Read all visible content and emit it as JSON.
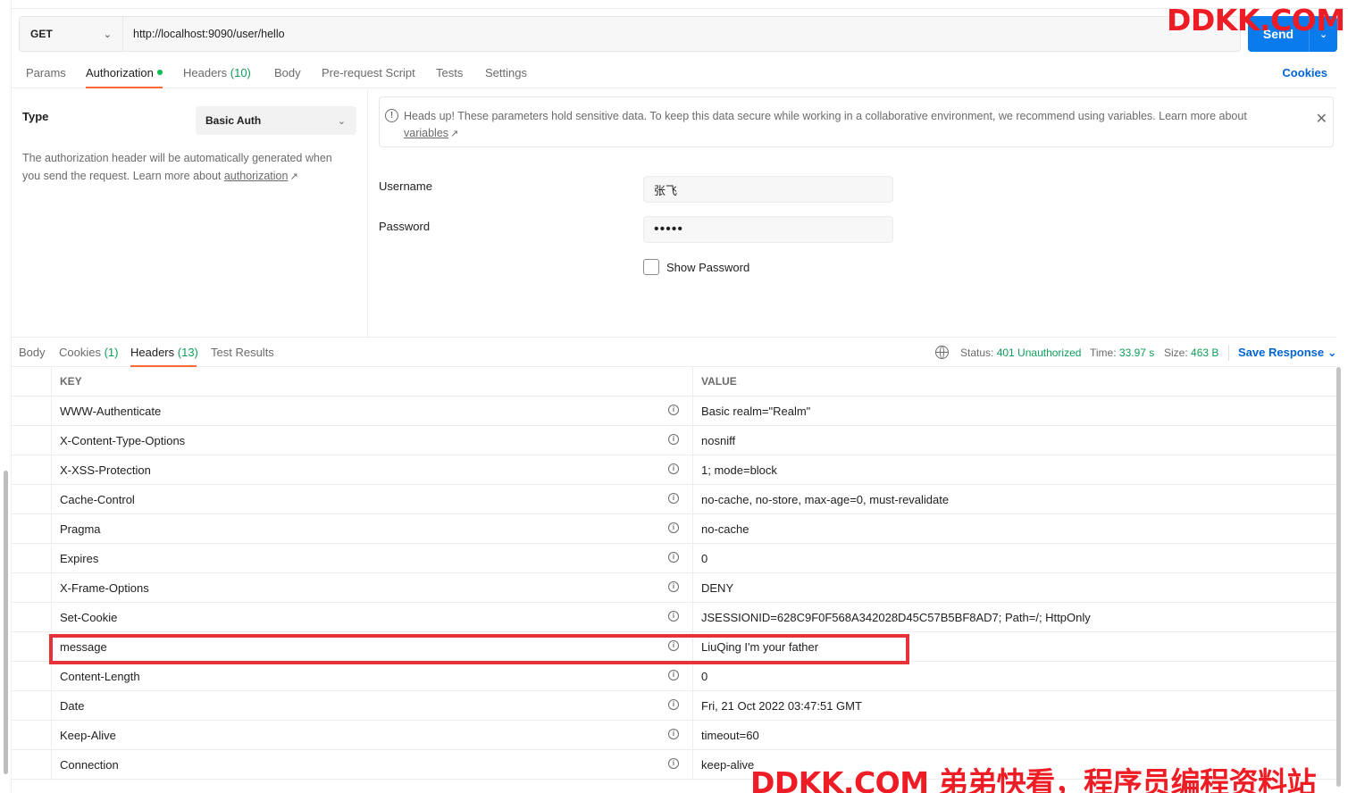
{
  "request": {
    "method": "GET",
    "url": "http://localhost:9090/user/hello",
    "send_label": "Send"
  },
  "request_tabs": [
    {
      "label": "Params",
      "count": ""
    },
    {
      "label": "Authorization",
      "count": ""
    },
    {
      "label": "Headers",
      "count": "(10)"
    },
    {
      "label": "Body",
      "count": ""
    },
    {
      "label": "Pre-request Script",
      "count": ""
    },
    {
      "label": "Tests",
      "count": ""
    },
    {
      "label": "Settings",
      "count": ""
    }
  ],
  "active_request_tab": "Authorization",
  "cookies_link": "Cookies",
  "auth": {
    "type_label": "Type",
    "type_value": "Basic Auth",
    "desc_prefix": "The authorization header will be automatically generated when you send the request. Learn more about",
    "desc_link": "authorization",
    "banner_text": "Heads up! These parameters hold sensitive data. To keep this data secure while working in a collaborative environment, we recommend using variables. Learn more about",
    "banner_link": "variables",
    "username_label": "Username",
    "username_value": "张飞",
    "password_label": "Password",
    "password_value": "•••••",
    "show_password_label": "Show Password"
  },
  "response_tabs": [
    {
      "label": "Body",
      "count": ""
    },
    {
      "label": "Cookies",
      "count": "(1)"
    },
    {
      "label": "Headers",
      "count": "(13)"
    },
    {
      "label": "Test Results",
      "count": ""
    }
  ],
  "active_response_tab": "Headers",
  "response_meta": {
    "status_label": "Status:",
    "status_value": "401 Unauthorized",
    "time_label": "Time:",
    "time_value": "33.97 s",
    "size_label": "Size:",
    "size_value": "463 B",
    "save_label": "Save Response"
  },
  "headers_table": {
    "columns": [
      "KEY",
      "VALUE"
    ],
    "rows": [
      {
        "key": "WWW-Authenticate",
        "value": "Basic realm=\"Realm\""
      },
      {
        "key": "X-Content-Type-Options",
        "value": "nosniff"
      },
      {
        "key": "X-XSS-Protection",
        "value": "1; mode=block"
      },
      {
        "key": "Cache-Control",
        "value": "no-cache, no-store, max-age=0, must-revalidate"
      },
      {
        "key": "Pragma",
        "value": "no-cache"
      },
      {
        "key": "Expires",
        "value": "0"
      },
      {
        "key": "X-Frame-Options",
        "value": "DENY"
      },
      {
        "key": "Set-Cookie",
        "value": "JSESSIONID=628C9F0F568A342028D45C57B5BF8AD7; Path=/; HttpOnly"
      },
      {
        "key": "message",
        "value": "LiuQing I'm your father"
      },
      {
        "key": "Content-Length",
        "value": "0"
      },
      {
        "key": "Date",
        "value": "Fri, 21 Oct 2022 03:47:51 GMT"
      },
      {
        "key": "Keep-Alive",
        "value": "timeout=60"
      },
      {
        "key": "Connection",
        "value": "keep-alive"
      }
    ]
  },
  "highlighted_row": "message",
  "watermark_top": "DDKK.COM",
  "watermark_bottom": "DDKK.COM 弟弟快看，程序员编程资料站",
  "colors": {
    "accent_orange": "#ff6c37",
    "send_blue": "#097bed",
    "status_green": "#0f9d58",
    "link_blue": "#0265d2",
    "highlight_red": "#e8323a"
  }
}
